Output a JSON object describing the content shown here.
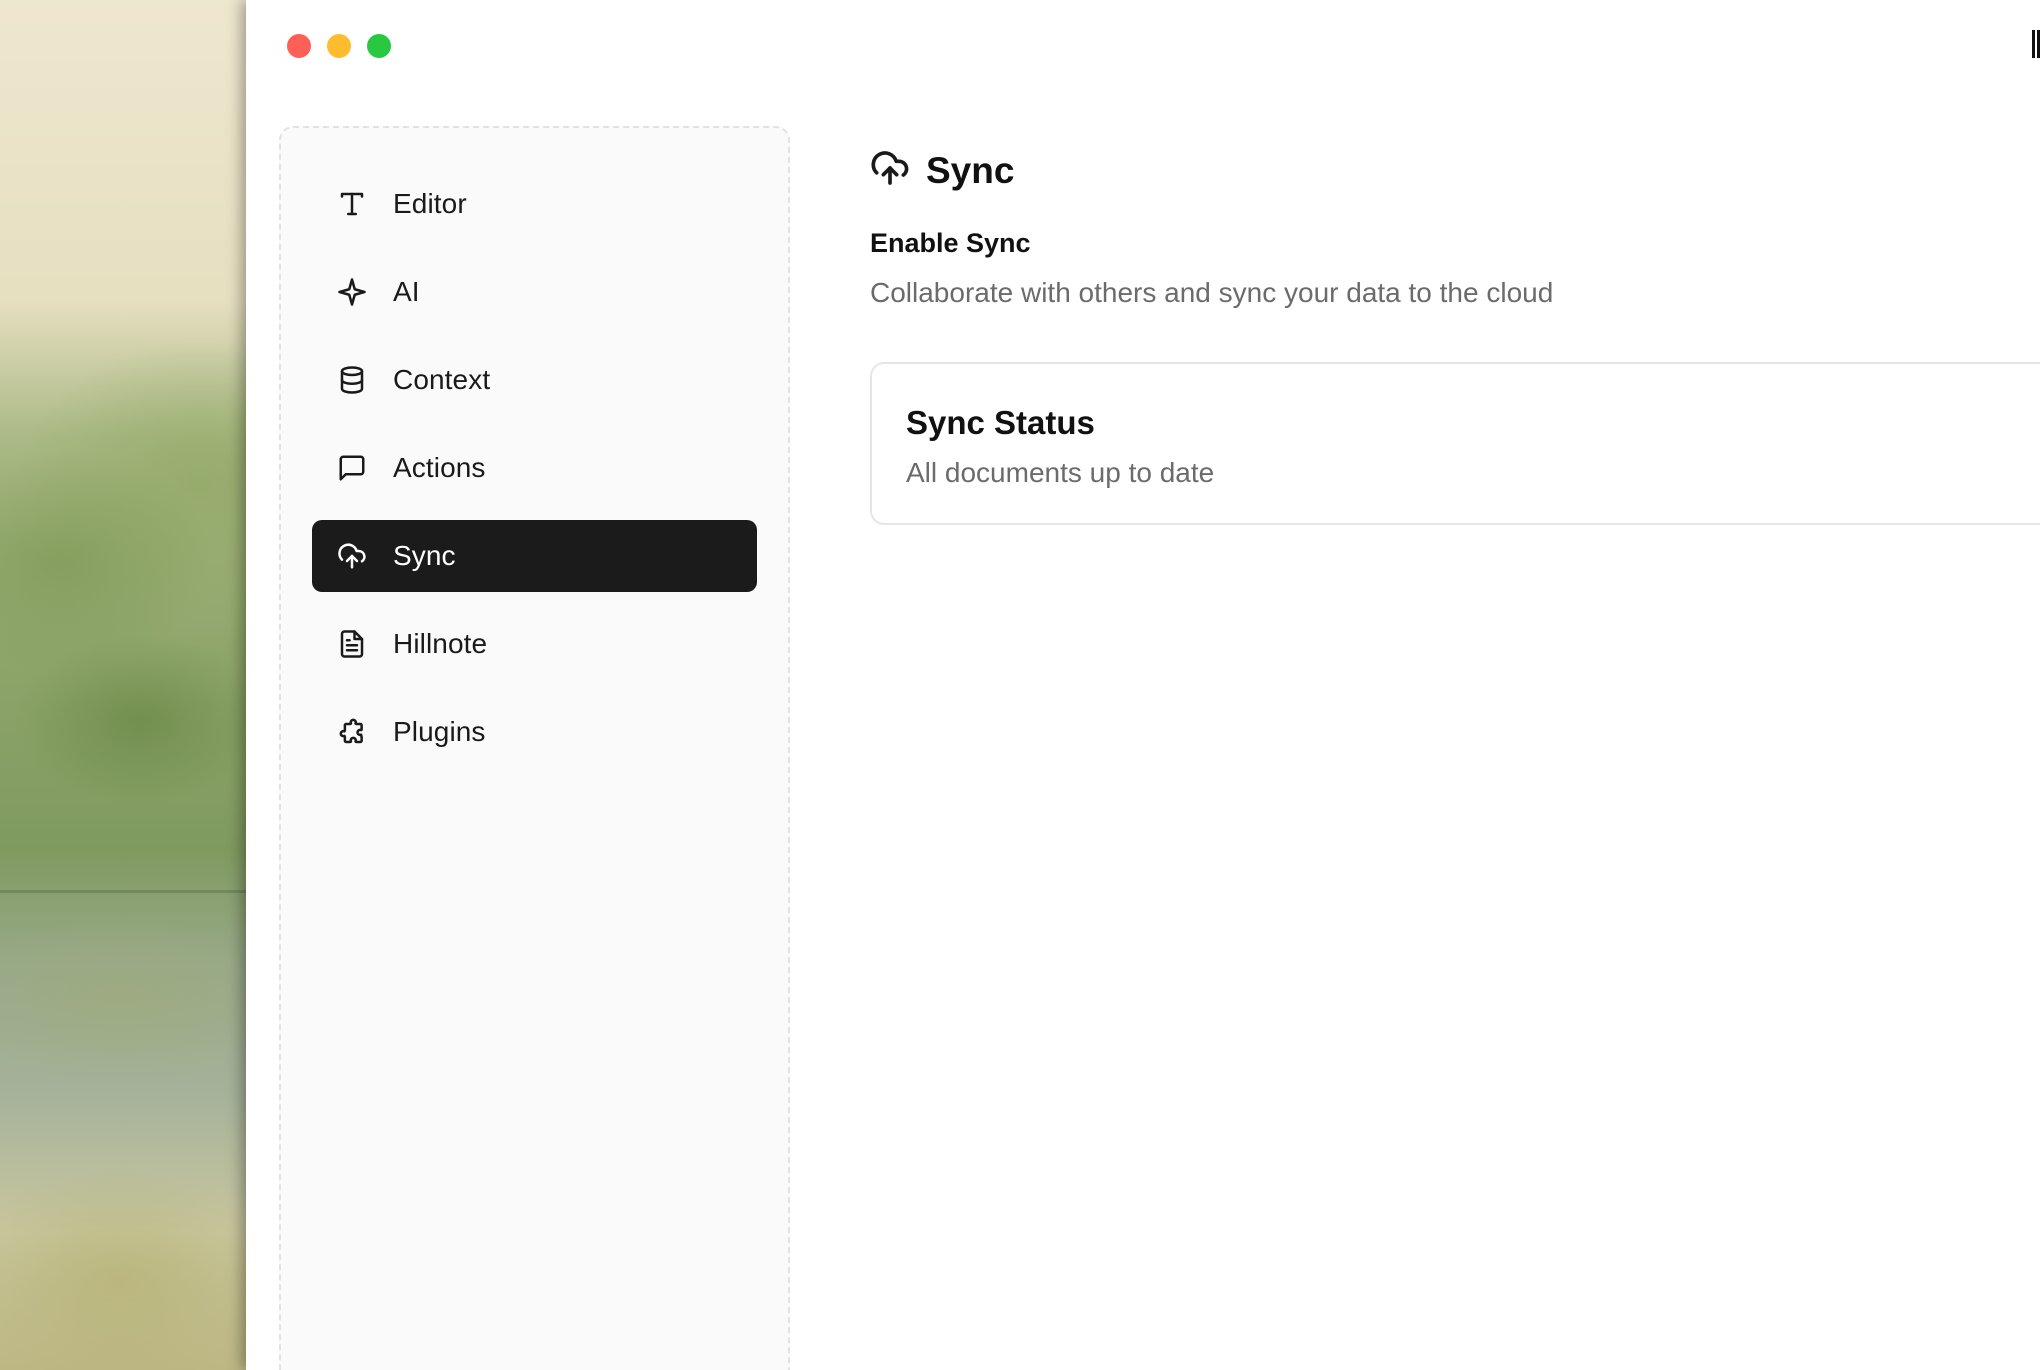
{
  "sidebar": {
    "items": [
      {
        "label": "Editor",
        "icon": "text-icon"
      },
      {
        "label": "AI",
        "icon": "sparkle-icon"
      },
      {
        "label": "Context",
        "icon": "database-icon"
      },
      {
        "label": "Actions",
        "icon": "message-square-icon"
      },
      {
        "label": "Sync",
        "icon": "cloud-upload-icon",
        "active": true
      },
      {
        "label": "Hillnote",
        "icon": "file-text-icon"
      },
      {
        "label": "Plugins",
        "icon": "puzzle-icon"
      }
    ]
  },
  "main": {
    "title": "Sync",
    "title_icon": "cloud-upload-icon",
    "setting": {
      "label": "Enable Sync",
      "description": "Collaborate with others and sync your data to the cloud"
    },
    "status_card": {
      "title": "Sync Status",
      "description": "All documents up to date"
    }
  },
  "colors": {
    "active_nav_bg": "#1b1b1b",
    "sidebar_bg": "#fafafa",
    "muted_text": "#6b6b6b",
    "close": "#fe5f57",
    "minimize": "#febc2e",
    "zoom": "#28c840"
  }
}
